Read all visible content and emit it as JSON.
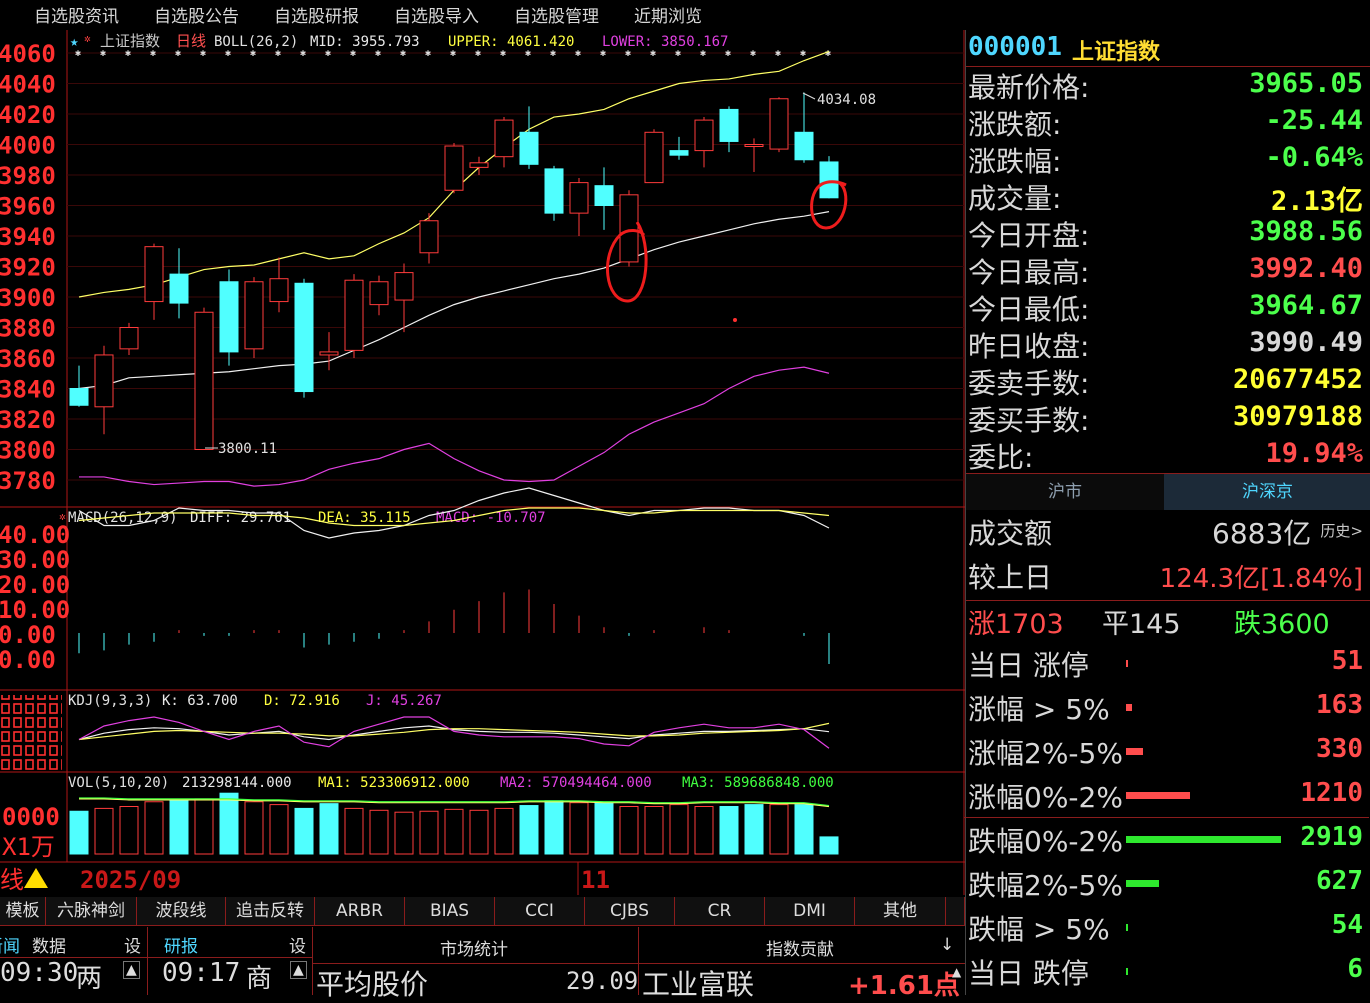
{
  "menu": [
    "自选股资讯",
    "自选股公告",
    "自选股研报",
    "自选股导入",
    "自选股管理",
    "近期浏览"
  ],
  "chart_data": {
    "type": "candlestick",
    "boll_header": {
      "name": "上证指数",
      "period": "日线",
      "indicator": "BOLL(26,2)",
      "mid_label": "MID: 3955.793",
      "upper_label": "UPPER: 4061.420",
      "lower_label": "LOWER: 3850.167"
    },
    "y_ticks": [
      "4060",
      "4040",
      "4020",
      "4000",
      "3980",
      "3960",
      "3940",
      "3920",
      "3900",
      "3880",
      "3860",
      "3840",
      "3820",
      "3800",
      "3780"
    ],
    "ylim": [
      3770,
      4068
    ],
    "candles": [
      {
        "o": 3840,
        "c": 3829,
        "h": 3855,
        "l": 3828
      },
      {
        "o": 3828,
        "c": 3862,
        "h": 3868,
        "l": 3810
      },
      {
        "o": 3866,
        "c": 3880,
        "h": 3883,
        "l": 3862
      },
      {
        "o": 3897,
        "c": 3933,
        "h": 3935,
        "l": 3885
      },
      {
        "o": 3915,
        "c": 3896,
        "h": 3932,
        "l": 3886
      },
      {
        "o": 3800,
        "c": 3890,
        "h": 3893,
        "l": 3800
      },
      {
        "o": 3910,
        "c": 3864,
        "h": 3918,
        "l": 3855
      },
      {
        "o": 3866,
        "c": 3910,
        "h": 3913,
        "l": 3860
      },
      {
        "o": 3897,
        "c": 3912,
        "h": 3926,
        "l": 3890
      },
      {
        "o": 3909,
        "c": 3838,
        "h": 3912,
        "l": 3834
      },
      {
        "o": 3862,
        "c": 3864,
        "h": 3877,
        "l": 3852
      },
      {
        "o": 3865,
        "c": 3911,
        "h": 3915,
        "l": 3860
      },
      {
        "o": 3895,
        "c": 3910,
        "h": 3914,
        "l": 3888
      },
      {
        "o": 3898,
        "c": 3916,
        "h": 3922,
        "l": 3877
      },
      {
        "o": 3929,
        "c": 3950,
        "h": 3955,
        "l": 3922
      },
      {
        "o": 3970,
        "c": 3999,
        "h": 4001,
        "l": 3968
      },
      {
        "o": 3985,
        "c": 3988,
        "h": 3992,
        "l": 3980
      },
      {
        "o": 3992,
        "c": 4016,
        "h": 4018,
        "l": 3985
      },
      {
        "o": 4008,
        "c": 3987,
        "h": 4025,
        "l": 3984
      },
      {
        "o": 3984,
        "c": 3955,
        "h": 3986,
        "l": 3950
      },
      {
        "o": 3955,
        "c": 3975,
        "h": 3978,
        "l": 3940
      },
      {
        "o": 3973,
        "c": 3960,
        "h": 3985,
        "l": 3944
      },
      {
        "o": 3923,
        "c": 3967,
        "h": 3970,
        "l": 3920
      },
      {
        "o": 3975,
        "c": 4008,
        "h": 4010,
        "l": 3975
      },
      {
        "o": 3996,
        "c": 3993,
        "h": 4005,
        "l": 3990
      },
      {
        "o": 3996,
        "c": 4016,
        "h": 4018,
        "l": 3985
      },
      {
        "o": 4023,
        "c": 4002,
        "h": 4025,
        "l": 3995
      },
      {
        "o": 3999,
        "c": 4000,
        "h": 4004,
        "l": 3982
      },
      {
        "o": 3997,
        "c": 4030,
        "h": 4031,
        "l": 3995
      },
      {
        "o": 4008,
        "c": 3990,
        "h": 4034.08,
        "l": 3988
      },
      {
        "o": 3988.56,
        "c": 3965.05,
        "h": 3992.4,
        "l": 3964.67
      }
    ],
    "boll_upper": [
      3900,
      3903,
      3905,
      3908,
      3913,
      3918,
      3920,
      3921,
      3925,
      3929,
      3925,
      3927,
      3935,
      3942,
      3952,
      3970,
      3985,
      3998,
      4010,
      4018,
      4020,
      4023,
      4030,
      4035,
      4040,
      4042,
      4043,
      4046,
      4048,
      4055,
      4061
    ],
    "boll_mid": [
      3840,
      3842,
      3847,
      3848,
      3849,
      3850,
      3851,
      3853,
      3855,
      3856,
      3858,
      3865,
      3872,
      3880,
      3888,
      3895,
      3900,
      3904,
      3908,
      3912,
      3915,
      3919,
      3925,
      3931,
      3936,
      3940,
      3944,
      3948,
      3951,
      3953,
      3956
    ],
    "boll_lower": [
      3782,
      3782,
      3779,
      3777,
      3778,
      3779,
      3779,
      3776,
      3777,
      3780,
      3787,
      3791,
      3794,
      3800,
      3804,
      3794,
      3786,
      3780,
      3779,
      3780,
      3789,
      3798,
      3810,
      3818,
      3824,
      3830,
      3840,
      3848,
      3852,
      3854,
      3850
    ],
    "high_label": "4034.08",
    "low_label": "3800.11",
    "macd_header": {
      "indicator": "MACD(26,12,9)",
      "diff_label": "DIFF: 29.761",
      "dea_label": "DEA: 35.115",
      "macd_label": "MACD: -10.707"
    },
    "macd_ticks": [
      "40.00",
      "30.00",
      "20.00",
      "10.00",
      "0.00",
      "0.00"
    ],
    "macd_ylim": [
      -5,
      45
    ],
    "diff": [
      37,
      31,
      31,
      33,
      38,
      37,
      37,
      36,
      36,
      29,
      26,
      28,
      29,
      31,
      35,
      37,
      41,
      44,
      46,
      43,
      40,
      37,
      35,
      37,
      37,
      38,
      38,
      37,
      37,
      35,
      30
    ],
    "dea": [
      33,
      34,
      35,
      36,
      36,
      36,
      36,
      35,
      35,
      34,
      32,
      31,
      31,
      31,
      32,
      33,
      35,
      37,
      38,
      38,
      38,
      37,
      36,
      36,
      37,
      37,
      37,
      37,
      37,
      36,
      35
    ],
    "macd_hist": [
      -7,
      -6,
      -4,
      -3,
      1,
      -1,
      -1,
      1,
      1,
      -5,
      -4,
      -3,
      -2,
      1,
      4,
      8,
      11,
      14,
      15,
      10,
      6,
      2,
      -1,
      1,
      0,
      2,
      1,
      0,
      0,
      -1,
      -10.707
    ],
    "kdj_header": {
      "indicator": "KDJ(9,3,3)",
      "k_label": "K: 63.700",
      "d_label": "D: 72.916",
      "j_label": "J: 45.267"
    },
    "kdj_k": [
      55,
      62,
      66,
      68,
      67,
      64,
      60,
      62,
      64,
      58,
      55,
      60,
      64,
      68,
      70,
      66,
      64,
      63,
      63,
      62,
      60,
      58,
      56,
      60,
      62,
      64,
      64,
      65,
      66,
      67,
      63.7
    ],
    "kdj_d": [
      55,
      58,
      61,
      64,
      65,
      64,
      63,
      62,
      62,
      61,
      59,
      59,
      61,
      63,
      66,
      67,
      67,
      66,
      65,
      64,
      63,
      61,
      59,
      59,
      60,
      62,
      63,
      64,
      65,
      67,
      72.9
    ],
    "kdj_j": [
      55,
      70,
      76,
      80,
      74,
      64,
      55,
      64,
      70,
      52,
      47,
      64,
      72,
      80,
      80,
      64,
      60,
      58,
      58,
      58,
      56,
      50,
      48,
      63,
      68,
      72,
      68,
      68,
      72,
      66,
      45.3
    ],
    "vol_header": {
      "indicator": "VOL(5,10,20)",
      "vol_label": "213298144.000",
      "ma1_label": "MA1: 523306912.000",
      "ma2_label": "MA2: 570494464.000",
      "ma3_label": "MA3: 589686848.000"
    },
    "vol_ticks": [
      "0000",
      "X1万"
    ],
    "volumes": [
      45,
      48,
      50,
      55,
      57,
      58,
      64,
      55,
      52,
      48,
      53,
      48,
      46,
      44,
      45,
      47,
      46,
      48,
      51,
      56,
      54,
      54,
      50,
      50,
      52,
      50,
      50,
      52,
      52,
      52,
      18
    ],
    "vol_up": [
      false,
      true,
      true,
      true,
      false,
      true,
      false,
      true,
      true,
      false,
      false,
      true,
      true,
      true,
      true,
      true,
      true,
      true,
      false,
      false,
      true,
      false,
      true,
      true,
      true,
      true,
      false,
      false,
      true,
      false,
      false
    ],
    "vol_ma": [
      58,
      58,
      57,
      57,
      57,
      57,
      57,
      56,
      56,
      55,
      55,
      55,
      54,
      54,
      54,
      54,
      54,
      54,
      55,
      55,
      55,
      54,
      54,
      53,
      53,
      54,
      54,
      54,
      53,
      53,
      50
    ],
    "x_labels": [
      "2025/09",
      "11"
    ],
    "annotation_circles": 2
  },
  "quote": {
    "code": "000001",
    "name": "上证指数",
    "rows": [
      {
        "label": "最新价格:",
        "value": "3965.05",
        "color": "#4cff4c"
      },
      {
        "label": "涨跌额:",
        "value": "-25.44",
        "color": "#4cff4c"
      },
      {
        "label": "涨跌幅:",
        "value": "-0.64%",
        "color": "#4cff4c"
      },
      {
        "label": "成交量:",
        "value": "2.13亿",
        "color": "#ffff33"
      },
      {
        "label": "今日开盘:",
        "value": "3988.56",
        "color": "#4cff4c"
      },
      {
        "label": "今日最高:",
        "value": "3992.40",
        "color": "#ff4d4d"
      },
      {
        "label": "今日最低:",
        "value": "3964.67",
        "color": "#4cff4c"
      },
      {
        "label": "昨日收盘:",
        "value": "3990.49",
        "color": "#d8d8d8"
      },
      {
        "label": "委卖手数:",
        "value": "20677452",
        "color": "#ffff33"
      },
      {
        "label": "委买手数:",
        "value": "30979188",
        "color": "#ffff33"
      },
      {
        "label": "委比:",
        "value": "19.94%",
        "color": "#ff4d4d"
      }
    ]
  },
  "market_tabs": [
    "沪市",
    "沪深京"
  ],
  "breadth": {
    "turnover_label": "成交额",
    "turnover_value": "6883亿",
    "history_link": "历史>",
    "vs_label": "较上日",
    "vs_value": "124.3亿[1.84%]",
    "up_label": "涨1703",
    "flat_label": "平145",
    "down_label": "跌3600",
    "rows": [
      {
        "label": "当日 涨停",
        "value": "51",
        "ratio": 0.01,
        "color": "#ff4d4d"
      },
      {
        "label": "涨幅 > 5%",
        "value": "163",
        "ratio": 0.04,
        "color": "#ff4d4d"
      },
      {
        "label": "涨幅2%-5%",
        "value": "330",
        "ratio": 0.11,
        "color": "#ff4d4d"
      },
      {
        "label": "涨幅0%-2%",
        "value": "1210",
        "ratio": 0.41,
        "color": "#ff4d4d"
      },
      {
        "label": "跌幅0%-2%",
        "value": "2919",
        "ratio": 1.0,
        "color": "#2ee82e"
      },
      {
        "label": "跌幅2%-5%",
        "value": "627",
        "ratio": 0.21,
        "color": "#2ee82e"
      },
      {
        "label": "跌幅 > 5%",
        "value": "54",
        "ratio": 0.01,
        "color": "#2ee82e"
      },
      {
        "label": "当日 跌停",
        "value": "6",
        "ratio": 0.0,
        "color": "#2ee82e"
      }
    ]
  },
  "toolbar": {
    "left_label": "线",
    "buttons": [
      "模板",
      "六脉神剑",
      "波段线",
      "追击反转",
      "ARBR",
      "BIAS",
      "CCI",
      "CJBS",
      "CR",
      "DMI",
      "其他"
    ]
  },
  "bottom": {
    "tab_news": "新闻",
    "tab_data": "数据",
    "tab_set1": "设",
    "tab_report": "研报",
    "tab_set2": "设",
    "time1": "09:30",
    "news1": "两",
    "time2": "09:17",
    "news2": "商",
    "market_stats": "市场统计",
    "index_contrib": "指数贡献",
    "avg_price_label": "平均股价",
    "avg_price_value": "29.09",
    "contrib_name": "工业富联",
    "contrib_value": "+1.61点"
  }
}
